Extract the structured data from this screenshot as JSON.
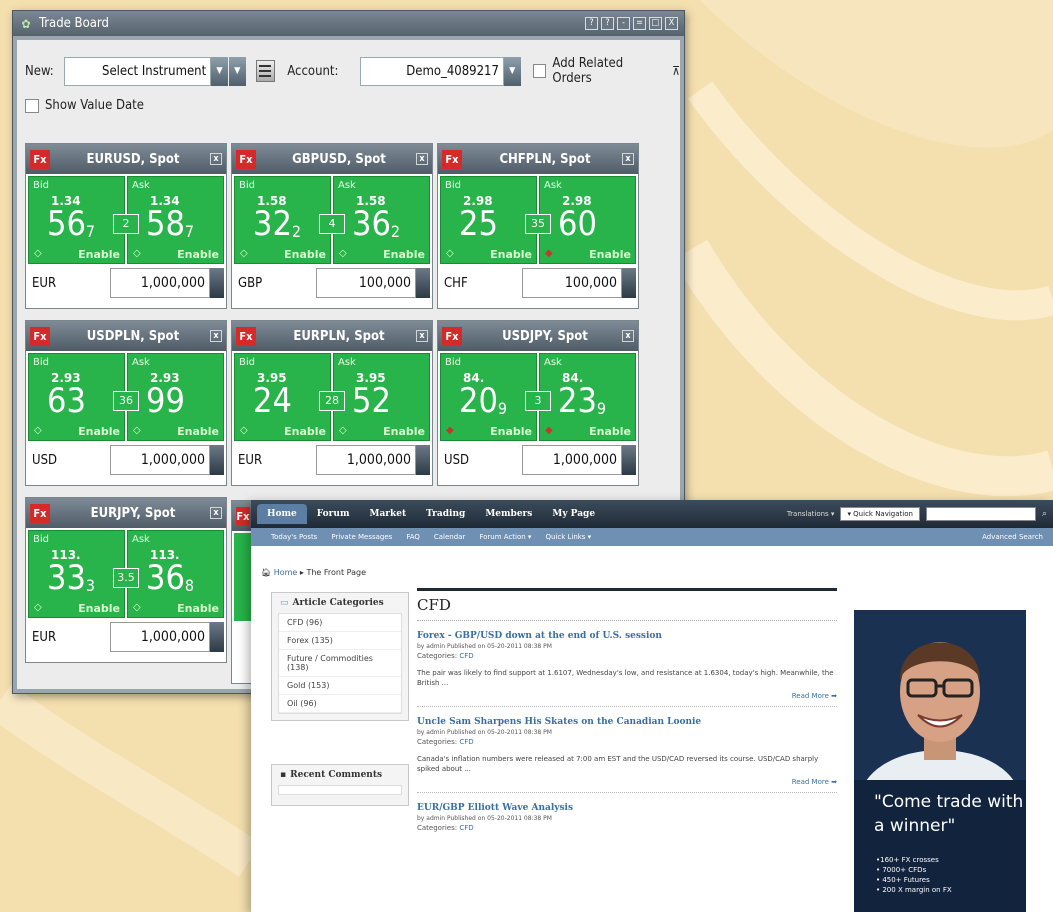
{
  "trade_board": {
    "title": "Trade Board",
    "window_buttons": [
      "?",
      "?",
      "-",
      "=",
      "□",
      "X"
    ],
    "new_label": "New:",
    "instrument_placeholder": "Select Instrument",
    "account_label": "Account:",
    "account_value": "Demo_4089217",
    "add_related_label": "Add Related Orders",
    "show_value_date_label": "Show Value Date",
    "fx_badge": "Fx",
    "bid_label": "Bid",
    "ask_label": "Ask",
    "enable_label": "Enable",
    "tiles": [
      {
        "pair": "EURUSD, Spot",
        "bid_big": "1.34",
        "bid_main": "56",
        "bid_pip": "7",
        "ask_big": "1.34",
        "ask_main": "58",
        "ask_pip": "7",
        "spread": "2",
        "ccy": "EUR",
        "amount": "1,000,000"
      },
      {
        "pair": "GBPUSD, Spot",
        "bid_big": "1.58",
        "bid_main": "32",
        "bid_pip": "2",
        "ask_big": "1.58",
        "ask_main": "36",
        "ask_pip": "2",
        "spread": "4",
        "ccy": "GBP",
        "amount": "100,000"
      },
      {
        "pair": "CHFPLN, Spot",
        "bid_big": "2.98",
        "bid_main": "25",
        "bid_pip": "",
        "ask_big": "2.98",
        "ask_main": "60",
        "ask_pip": "",
        "spread": "35",
        "ccy": "CHF",
        "amount": "100,000"
      },
      {
        "pair": "USDPLN, Spot",
        "bid_big": "2.93",
        "bid_main": "63",
        "bid_pip": "",
        "ask_big": "2.93",
        "ask_main": "99",
        "ask_pip": "",
        "spread": "36",
        "ccy": "USD",
        "amount": "1,000,000"
      },
      {
        "pair": "EURPLN, Spot",
        "bid_big": "3.95",
        "bid_main": "24",
        "bid_pip": "",
        "ask_big": "3.95",
        "ask_main": "52",
        "ask_pip": "",
        "spread": "28",
        "ccy": "EUR",
        "amount": "1,000,000"
      },
      {
        "pair": "USDJPY, Spot",
        "bid_big": "84.",
        "bid_main": "20",
        "bid_pip": "9",
        "ask_big": "84.",
        "ask_main": "23",
        "ask_pip": "9",
        "spread": "3",
        "ccy": "USD",
        "amount": "1,000,000"
      },
      {
        "pair": "EURJPY, Spot",
        "bid_big": "113.",
        "bid_main": "33",
        "bid_pip": "3",
        "ask_big": "113.",
        "ask_main": "36",
        "ask_pip": "8",
        "spread": "3.5",
        "ccy": "EUR",
        "amount": "1,000,000"
      }
    ]
  },
  "forum": {
    "nav": [
      "Home",
      "Forum",
      "Market",
      "Trading",
      "Members",
      "My Page"
    ],
    "translations": "Translations ▾",
    "quick_nav": "▾ Quick Navigation",
    "subnav": [
      "Today's Posts",
      "Private Messages",
      "FAQ",
      "Calendar",
      "Forum Action ▾",
      "Quick Links ▾"
    ],
    "advanced_search": "Advanced Search",
    "crumb_home": "Home",
    "crumb_page": "The Front Page",
    "categories_title": "Article Categories",
    "categories": [
      "CFD (96)",
      "Forex (135)",
      "Future / Commodities (138)",
      "Gold (153)",
      "Oil (96)"
    ],
    "recent_comments_title": "Recent Comments",
    "section_title": "CFD",
    "articles": [
      {
        "title": "Forex - GBP/USD down at the end of U.S. session",
        "meta": "by admin Published on 05-20-2011 08:38 PM",
        "cat_label": "Categories:",
        "cat": "CFD",
        "excerpt": "The pair was likely to find support at 1.6107, Wednesday's low, and resistance at 1.6304, today's high. Meanwhile, the British ...",
        "read_more": "Read More ➡"
      },
      {
        "title": "Uncle Sam Sharpens His Skates on the Canadian Loonie",
        "meta": "by admin Published on 05-20-2011 08:38 PM",
        "cat_label": "Categories:",
        "cat": "CFD",
        "excerpt": "Canada's inflation numbers were released at 7:00 am EST and the USD/CAD reversed its course. USD/CAD sharply spiked about ...",
        "read_more": "Read More ➡"
      },
      {
        "title": "EUR/GBP Elliott Wave Analysis",
        "meta": "by admin Published on 05-20-2011 08:38 PM",
        "cat_label": "Categories:",
        "cat": "CFD",
        "excerpt": "",
        "read_more": ""
      }
    ],
    "ad_quote": "\"Come trade with a winner\"",
    "ad_points": [
      "•160+ FX crosses",
      "• 7000+ CFDs",
      "• 450+ Futures",
      "• 200 X margin on FX"
    ]
  }
}
